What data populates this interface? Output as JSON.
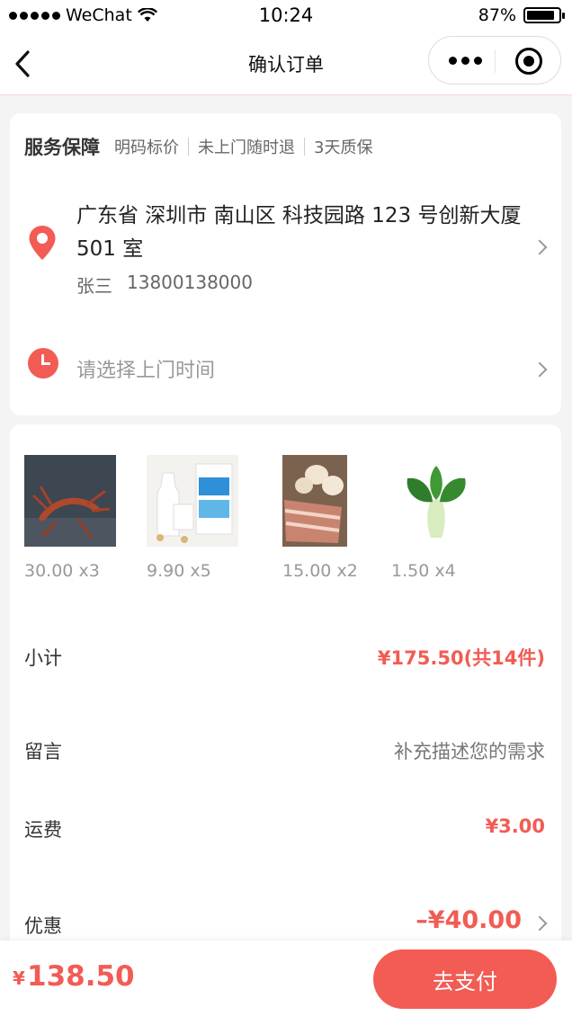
{
  "status_bar": {
    "carrier": "WeChat",
    "time": "10:24",
    "battery": "87%",
    "battery_level": 0.87
  },
  "nav": {
    "title": "确认订单"
  },
  "service": {
    "title": "服务保障",
    "tags": [
      "明码标价",
      "未上门随时退",
      "3天质保"
    ]
  },
  "address": {
    "full": "广东省 深圳市 南山区 科技园路 123 号创新大厦 501 室",
    "name": "张三",
    "phone": "13800138000"
  },
  "visit_time": {
    "placeholder": "请选择上门时间"
  },
  "products": [
    {
      "price": "30.00",
      "qty": "x3",
      "icon": "lobster-image"
    },
    {
      "price": "9.90",
      "qty": "x5",
      "icon": "milk-image"
    },
    {
      "price": "15.00",
      "qty": "x2",
      "icon": "pork-eggs-image"
    },
    {
      "price": "1.50",
      "qty": "x4",
      "icon": "bok-choy-image"
    }
  ],
  "summary": {
    "subtotal_label": "小计",
    "subtotal_value": "¥175.50(共14件)",
    "note_label": "留言",
    "note_placeholder": "补充描述您的需求",
    "shipping_label": "运费",
    "shipping_value": "¥3.00",
    "discount_label": "优惠",
    "discount_value": "–¥40.00"
  },
  "footer": {
    "currency": "¥",
    "total": "138.50",
    "pay_label": "去支付"
  },
  "colors": {
    "accent": "#f25c54",
    "background": "#f4f4f4"
  }
}
